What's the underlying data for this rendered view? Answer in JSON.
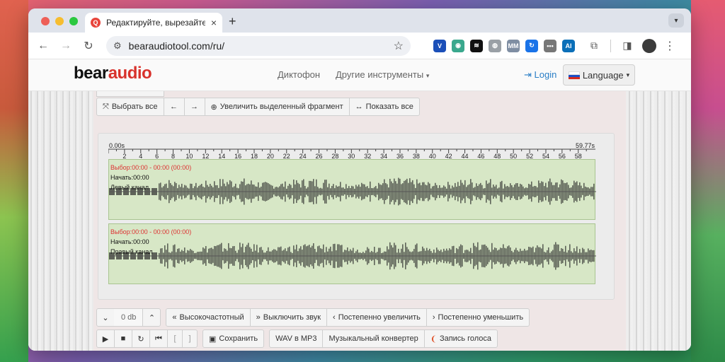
{
  "browser": {
    "tab_title": "Редактируйте, вырезайте, о",
    "url": "bearaudiotool.com/ru/",
    "new_tab": "+",
    "tab_close": "×",
    "extensions": [
      {
        "name": "vivaldi-icon",
        "color": "#1b4fb8",
        "glyph": "V"
      },
      {
        "name": "globe-green-icon",
        "color": "#3aa88d",
        "glyph": "◉"
      },
      {
        "name": "notion-like-icon",
        "color": "#111111",
        "glyph": "≋"
      },
      {
        "name": "globe-icon",
        "color": "#9aa0a6",
        "glyph": "◍"
      },
      {
        "name": "ext-mm-icon",
        "color": "#7f8ea3",
        "glyph": "MM"
      },
      {
        "name": "refresh-ext-icon",
        "color": "#1a73e8",
        "glyph": "↻"
      },
      {
        "name": "dots-ext-icon",
        "color": "#777777",
        "glyph": "•••"
      },
      {
        "name": "ai-ext-icon",
        "color": "#0b6fb8",
        "glyph": "AI"
      }
    ]
  },
  "site": {
    "logo_bear": "bear",
    "logo_audio": "audio",
    "nav": [
      "Диктофон",
      "Другие инструменты"
    ],
    "login": "Login",
    "language": "Language"
  },
  "toolbar_top": {
    "select_all": "Выбрать все",
    "prev": "←",
    "next": "→",
    "zoom_selection": "Увеличить выделенный фрагмент",
    "show_all": "Показать все"
  },
  "ruler": {
    "start": "0.00s",
    "end": "59.77s",
    "ticks": [
      "2",
      "4",
      "6",
      "8",
      "10",
      "12",
      "14",
      "16",
      "18",
      "20",
      "22",
      "24",
      "26",
      "28",
      "30",
      "32",
      "34",
      "36",
      "38",
      "40",
      "42",
      "44",
      "46",
      "48",
      "50",
      "52",
      "54",
      "56",
      "58"
    ]
  },
  "tracks": [
    {
      "selection": "Выбор:00:00 - 00:00 (00:00)",
      "start": "Начать:00:00",
      "channel": "Левый канал"
    },
    {
      "selection": "Выбор:00:00 - 00:00 (00:00)",
      "start": "Начать:00:00",
      "channel": "Правый канал"
    }
  ],
  "effects": {
    "volume_db": "0 db",
    "high_freq": "Высокочастотный",
    "mute": "Выключить звук",
    "fade_in": "Постепенно увеличить",
    "fade_out": "Постепенно уменьшить"
  },
  "playback": {
    "save": "Сохранить",
    "bracket_open": "[",
    "bracket_close": "]",
    "wav_to_mp3": "WAV в MP3",
    "music_converter": "Музыкальный конвертер",
    "voice_record": "Запись голоса"
  },
  "colors": {
    "accent_red": "#d8322c",
    "link_blue": "#2a7ec6",
    "track_bg": "#d7e7c6",
    "waveform": "#5e6359"
  }
}
